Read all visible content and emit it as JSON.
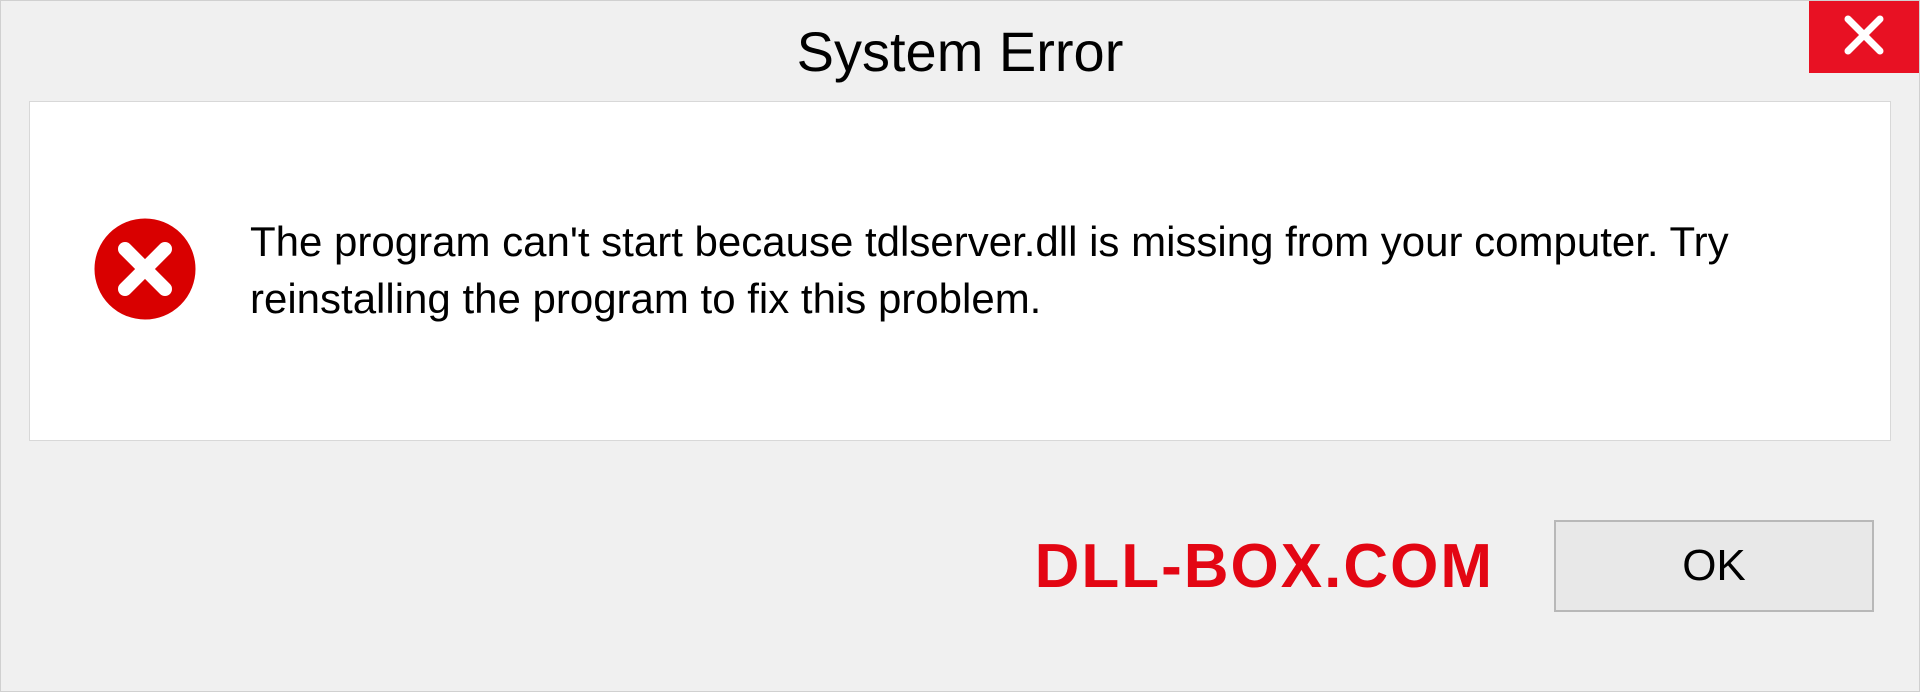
{
  "dialog": {
    "title": "System Error",
    "message": "The program can't start because tdlserver.dll is missing from your computer. Try reinstalling the program to fix this problem.",
    "ok_label": "OK"
  },
  "watermark": "DLL-BOX.COM",
  "colors": {
    "close_bg": "#e81123",
    "error_icon": "#d90000",
    "watermark": "#e30613"
  }
}
